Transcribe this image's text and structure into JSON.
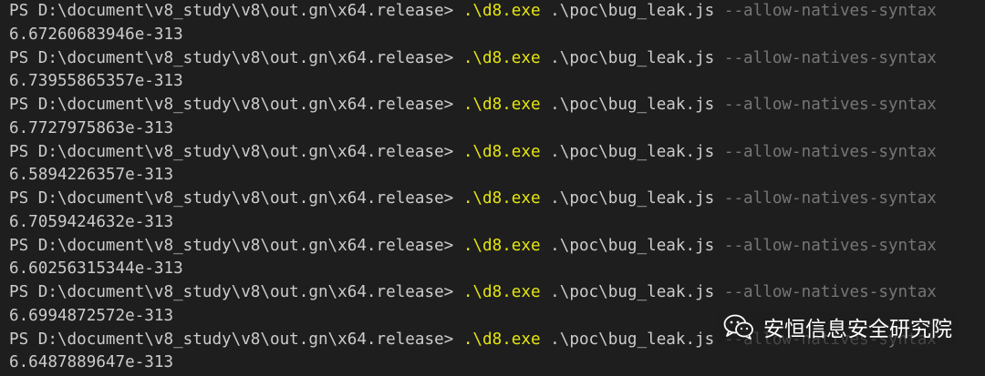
{
  "terminal": {
    "prompt": "PS D:\\document\\v8_study\\v8\\out.gn\\x64.release> ",
    "command_exe": ".\\d8.exe",
    "command_arg": " .\\poc\\bug_leak.js ",
    "command_flag": "--allow-natives-syntax",
    "runs": [
      {
        "output": "6.67260683946e-313"
      },
      {
        "output": "6.73955865357e-313"
      },
      {
        "output": "6.7727975863e-313"
      },
      {
        "output": "6.5894226357e-313"
      },
      {
        "output": "6.7059424632e-313"
      },
      {
        "output": "6.60256315344e-313"
      },
      {
        "output": "6.6994872572e-313"
      },
      {
        "output": "6.6487889647e-313"
      }
    ]
  },
  "watermark": {
    "text": "安恒信息安全研究院",
    "icon": "wechat-icon"
  },
  "colors": {
    "background": "#1e1e1e",
    "text": "#cccccc",
    "command": "#e5e510",
    "flag": "#767676"
  }
}
